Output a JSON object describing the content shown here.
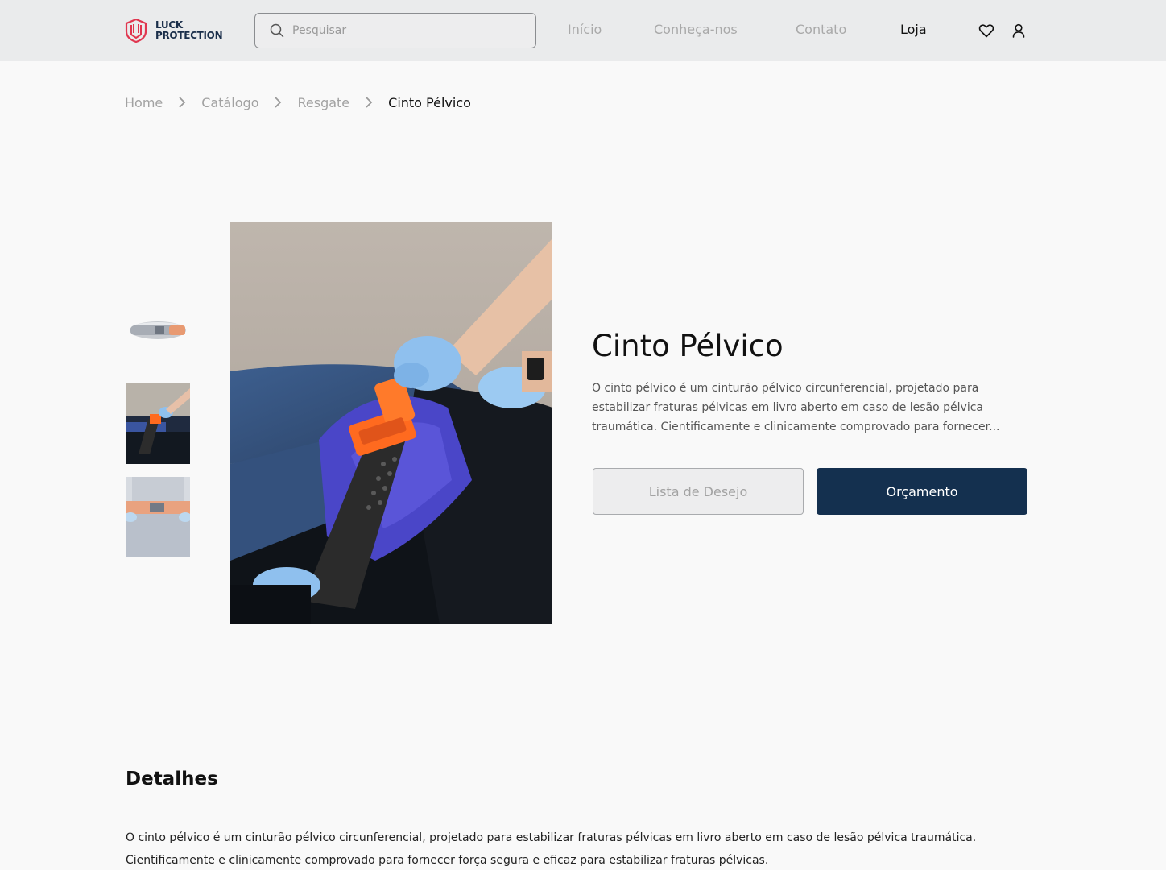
{
  "header": {
    "logo_line1": "LUCK",
    "logo_line2": "PROTECTION",
    "search_placeholder": "Pesquisar",
    "nav": [
      {
        "label": "Início"
      },
      {
        "label": "Conheça-nos"
      },
      {
        "label": "Contato"
      },
      {
        "label": "Loja"
      }
    ],
    "icons": [
      "heart-icon",
      "user-icon"
    ]
  },
  "breadcrumb": [
    "Home",
    "Catálogo",
    "Resgate",
    "Cinto Pélvico"
  ],
  "product": {
    "title": "Cinto Pélvico",
    "description": "O cinto pélvico é um cinturão pélvico circunferencial, projetado para estabilizar fraturas pélvicas em livro aberto em caso de lesão pélvica traumática. Cientificamente e clinicamente comprovado para fornecer...",
    "wishlist_label": "Lista de Desejo",
    "quote_label": "Orçamento"
  },
  "details": {
    "title": "Detalhes",
    "text": "O cinto pélvico é um cinturão pélvico circunferencial, projetado para estabilizar fraturas pélvicas em livro aberto em caso de lesão pélvica traumática. Cientificamente e clinicamente comprovado para fornecer força segura e eficaz para estabilizar fraturas pélvicas."
  },
  "colors": {
    "header_bg": "#eaebec",
    "page_bg": "#f9f9f9",
    "primary": "#14304f",
    "logo_accent": "#e0364f"
  }
}
